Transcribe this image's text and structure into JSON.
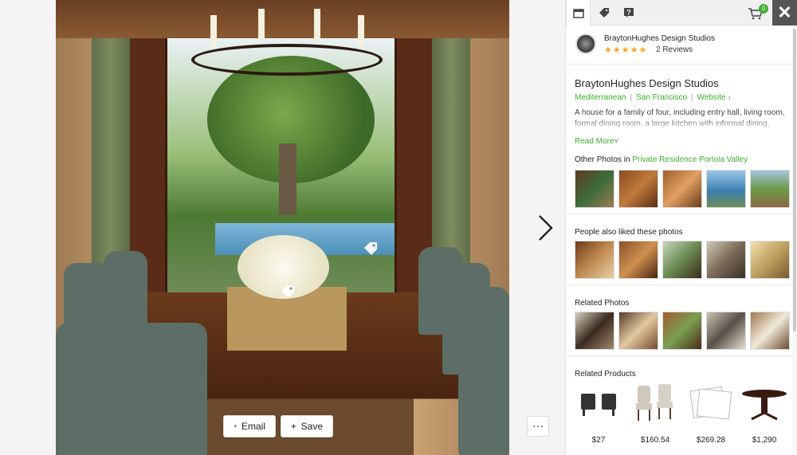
{
  "actions": {
    "email_label": "Email",
    "save_label": "Save",
    "more_label": "···"
  },
  "panel": {
    "cart_count": "0",
    "close_label": "✕",
    "pro": {
      "name": "BraytonHughes Design Studios",
      "stars": "★★★★★",
      "reviews": "2 Reviews"
    },
    "project": {
      "title": "BraytonHughes Design Studios",
      "style": "Mediterranean",
      "location": "San Francisco",
      "website": "Website",
      "description": "A house for a family of four, including entry hall, living room, formal dining room, a large kitchen with informal dining, mud",
      "read_more": "Read More"
    },
    "other_photos": {
      "prefix": "Other Photos in ",
      "project_link": "Private Residence Portola Valley"
    },
    "people_also_liked": "People also liked these photos",
    "related_photos": "Related Photos",
    "related_products": "Related Products",
    "products": [
      {
        "price": "$27"
      },
      {
        "price": "$160.54"
      },
      {
        "price": "$269.28"
      },
      {
        "price": "$1,290"
      }
    ]
  },
  "colors": {
    "accent": "#3dae2b",
    "star": "#f5a623",
    "close_bg": "#555555"
  }
}
